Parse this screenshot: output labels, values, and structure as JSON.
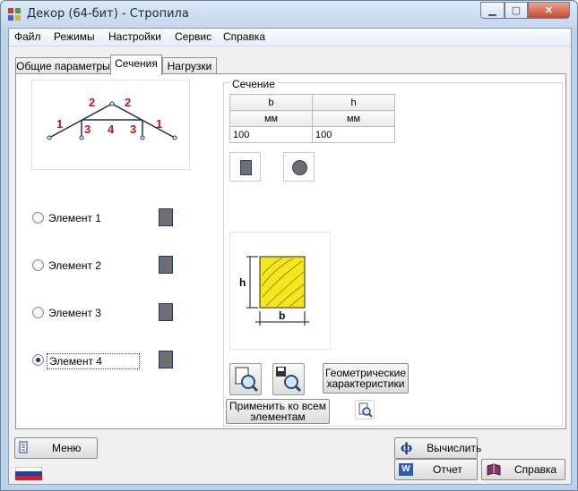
{
  "window": {
    "title": "Декор (64-бит) - Стропила"
  },
  "menu": [
    "Файл",
    "Режимы",
    "Настройки",
    "Сервис",
    "Справка"
  ],
  "tabs": [
    "Общие параметры",
    "Сечения",
    "Нагрузки"
  ],
  "truss": {
    "labels": [
      "1",
      "2",
      "2",
      "1",
      "3",
      "4",
      "3"
    ]
  },
  "elements": [
    {
      "label": "Элемент 1",
      "checked": false
    },
    {
      "label": "Элемент 2",
      "checked": false
    },
    {
      "label": "Элемент 3",
      "checked": false
    },
    {
      "label": "Элемент 4",
      "checked": true
    }
  ],
  "section": {
    "label": "Сечение",
    "columns": [
      "b",
      "h"
    ],
    "units": [
      "мм",
      "мм"
    ],
    "values": [
      "100",
      "100"
    ],
    "dims": {
      "h": "h",
      "b": "b"
    }
  },
  "buttons": {
    "geometry": "Геометрические характеристики",
    "apply_all": "Применить ко всем элементам",
    "menu": "Меню",
    "calculate": "Вычислить",
    "report": "Отчет",
    "help": "Справка"
  },
  "icons": {
    "calculate": "phi-icon",
    "report": "word-icon",
    "help": "book-icon",
    "menu": "menu-icon"
  },
  "colors": {
    "truss": "#1f2d5a",
    "truss_labels": "#c0181b",
    "wood": "#f5e81a",
    "swatch": "#6f6f6f"
  }
}
